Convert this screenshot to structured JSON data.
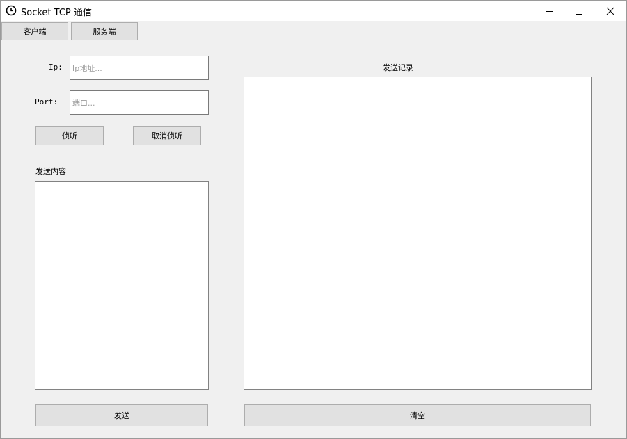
{
  "window": {
    "title": "Socket TCP 通信",
    "icon": "clock-icon",
    "controls": [
      "minimize-icon",
      "maximize-icon",
      "close-icon"
    ]
  },
  "tabs": {
    "client": "客户端",
    "server": "服务端"
  },
  "form": {
    "ip_label": "Ip:",
    "ip_placeholder": "Ip地址...",
    "port_label": "Port:",
    "port_placeholder": "端口..."
  },
  "buttons": {
    "listen": "侦听",
    "cancel_listen": "取消侦听",
    "send": "发送",
    "clear": "清空"
  },
  "send_content_label": "发送内容",
  "send_log_label": "发送记录"
}
